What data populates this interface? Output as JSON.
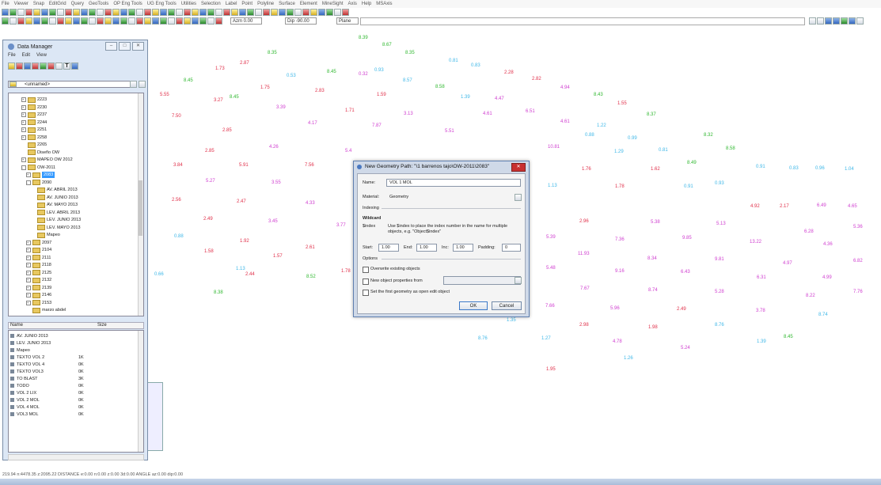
{
  "menubar": [
    "File",
    "Viewer",
    "Snap",
    "EditGrid",
    "Query",
    "GeoTools",
    "OP Eng Tools",
    "UG Eng Tools",
    "Utilities",
    "Selection",
    "Label",
    "Point",
    "Polyline",
    "Surface",
    "Element",
    "MineSight",
    "Axis",
    "Help",
    "MSAxis"
  ],
  "toolbar": {
    "azm": "Azm 0.00",
    "dip": "Dip -90.00",
    "plane_label": "Plane"
  },
  "data_manager": {
    "title": "Data Manager",
    "menu": [
      "File",
      "Edit",
      "View"
    ],
    "combo": "<unnamed>",
    "tree": [
      {
        "label": "2223",
        "indent": 2,
        "exp": "+"
      },
      {
        "label": "2230",
        "indent": 2,
        "exp": "+"
      },
      {
        "label": "2237",
        "indent": 2,
        "exp": "+"
      },
      {
        "label": "2244",
        "indent": 2,
        "exp": "+"
      },
      {
        "label": "2251",
        "indent": 2,
        "exp": "+"
      },
      {
        "label": "2258",
        "indent": 2,
        "exp": "+"
      },
      {
        "label": "2265",
        "indent": 2,
        "exp": ""
      },
      {
        "label": "Diseño OW",
        "indent": 2,
        "exp": ""
      },
      {
        "label": "MAPEO OW 2012",
        "indent": 2,
        "exp": "+"
      },
      {
        "label": "OW-2011",
        "indent": 2,
        "exp": "-"
      },
      {
        "label": "2083",
        "indent": 3,
        "exp": "+",
        "selected": true
      },
      {
        "label": "2090",
        "indent": 3,
        "exp": "-"
      },
      {
        "label": "AV. ABRIL 2013",
        "indent": 4,
        "exp": ""
      },
      {
        "label": "AV. JUNIO 2013",
        "indent": 4,
        "exp": ""
      },
      {
        "label": "AV. MAYO 2013",
        "indent": 4,
        "exp": ""
      },
      {
        "label": "LEV. ABRIL 2013",
        "indent": 4,
        "exp": ""
      },
      {
        "label": "LEV. JUNIO 2013",
        "indent": 4,
        "exp": ""
      },
      {
        "label": "LEV. MAYO 2013",
        "indent": 4,
        "exp": ""
      },
      {
        "label": "Mapeo",
        "indent": 4,
        "exp": ""
      },
      {
        "label": "2097",
        "indent": 3,
        "exp": "+"
      },
      {
        "label": "2104",
        "indent": 3,
        "exp": "+"
      },
      {
        "label": "2111",
        "indent": 3,
        "exp": "+"
      },
      {
        "label": "2118",
        "indent": 3,
        "exp": "+"
      },
      {
        "label": "2125",
        "indent": 3,
        "exp": "+"
      },
      {
        "label": "2132",
        "indent": 3,
        "exp": "+"
      },
      {
        "label": "2139",
        "indent": 3,
        "exp": "+"
      },
      {
        "label": "2146",
        "indent": 3,
        "exp": "+"
      },
      {
        "label": "2153",
        "indent": 3,
        "exp": "+"
      },
      {
        "label": "marzo abdel",
        "indent": 3,
        "exp": ""
      }
    ],
    "list_headers": [
      "Name",
      "Size"
    ],
    "list": [
      {
        "name": "AV. JUNIO 2013",
        "size": ""
      },
      {
        "name": "LEV. JUNIO 2013",
        "size": ""
      },
      {
        "name": "Mapeo",
        "size": ""
      },
      {
        "name": "TEXTO VOL 2",
        "size": "1K"
      },
      {
        "name": "TEXTO VOL 4",
        "size": "0K"
      },
      {
        "name": "TEXTO VOL3",
        "size": "0K"
      },
      {
        "name": "TO BLAST",
        "size": "3K"
      },
      {
        "name": "TODO",
        "size": "0K"
      },
      {
        "name": "VOL 2 LIX",
        "size": "0K"
      },
      {
        "name": "VOL 2 MOL",
        "size": "0K"
      },
      {
        "name": "VOL 4 MOL",
        "size": "0K"
      },
      {
        "name": "VOL3 MOL",
        "size": "0K"
      }
    ]
  },
  "dialog": {
    "title": "New Geometry  Path: \"\\1 barrenos tajo\\OW-2011\\2083\"",
    "name_label": "Name:",
    "name_value": "VOL 1 MOL",
    "material_label": "Material:",
    "material_value": "Geometry",
    "indexing_label": "Indexing",
    "wildcard_label": "Wildcard",
    "index_token": "$index",
    "help_text": "Use $index to place the index number in the name for multiple objects, e.g. \"Object$index\"",
    "start_label": "Start:",
    "start_value": "1.00",
    "end_label": "End:",
    "end_value": "1.00",
    "inc_label": "Inc:",
    "inc_value": "1.00",
    "padding_label": "Padding:",
    "padding_value": "0",
    "options_label": "Options",
    "opt1": "Overwrite existing objects",
    "opt2": "New object properties from",
    "opt3": "Set the first geometry as open edit object",
    "ok": "OK",
    "cancel": "Cancel"
  },
  "canvas_colors": {
    "red": "#e0304a",
    "green": "#30b830",
    "cyan": "#40b8e8",
    "magenta": "#d040d0"
  },
  "values": [
    {
      "t": "8.39",
      "c": "green"
    },
    {
      "t": "8.67",
      "c": "green"
    },
    {
      "t": "8.35",
      "c": "green"
    },
    {
      "t": "8.35",
      "c": "green"
    },
    {
      "t": "1.73",
      "c": "red"
    },
    {
      "t": "2.87",
      "c": "red"
    },
    {
      "t": "8.45",
      "c": "green"
    },
    {
      "t": "0.53",
      "c": "cyan"
    },
    {
      "t": "8.45",
      "c": "green"
    },
    {
      "t": "0.32",
      "c": "magenta"
    },
    {
      "t": "0.93",
      "c": "cyan"
    },
    {
      "t": "8.57",
      "c": "cyan"
    },
    {
      "t": "0.81",
      "c": "cyan"
    },
    {
      "t": "0.83",
      "c": "cyan"
    },
    {
      "t": "2.28",
      "c": "red"
    },
    {
      "t": "2.82",
      "c": "red"
    },
    {
      "t": "1.75",
      "c": "red"
    },
    {
      "t": "2.83",
      "c": "red"
    },
    {
      "t": "5.55",
      "c": "red"
    },
    {
      "t": "3.27",
      "c": "red"
    },
    {
      "t": "8.45",
      "c": "green"
    },
    {
      "t": "1.59",
      "c": "red"
    },
    {
      "t": "8.58",
      "c": "green"
    },
    {
      "t": "1.39",
      "c": "cyan"
    },
    {
      "t": "4.47",
      "c": "magenta"
    },
    {
      "t": "4.94",
      "c": "magenta"
    },
    {
      "t": "8.43",
      "c": "green"
    },
    {
      "t": "1.55",
      "c": "red"
    },
    {
      "t": "7.50",
      "c": "red"
    },
    {
      "t": "3.39",
      "c": "magenta"
    },
    {
      "t": "1.71",
      "c": "red"
    },
    {
      "t": "3.13",
      "c": "magenta"
    },
    {
      "t": "4.61",
      "c": "magenta"
    },
    {
      "t": "6.51",
      "c": "magenta"
    },
    {
      "t": "8.37",
      "c": "green"
    },
    {
      "t": "2.85",
      "c": "red"
    },
    {
      "t": "4.17",
      "c": "magenta"
    },
    {
      "t": "7.87",
      "c": "magenta"
    },
    {
      "t": "5.51",
      "c": "magenta"
    },
    {
      "t": "4.61",
      "c": "magenta"
    },
    {
      "t": "1.22",
      "c": "cyan"
    },
    {
      "t": "0.88",
      "c": "cyan"
    },
    {
      "t": "0.99",
      "c": "cyan"
    },
    {
      "t": "8.32",
      "c": "green"
    },
    {
      "t": "2.85",
      "c": "red"
    },
    {
      "t": "4.26",
      "c": "magenta"
    },
    {
      "t": "5.4",
      "c": "magenta"
    },
    {
      "t": "10.81",
      "c": "magenta"
    },
    {
      "t": "1.29",
      "c": "cyan"
    },
    {
      "t": "0.81",
      "c": "cyan"
    },
    {
      "t": "8.58",
      "c": "green"
    },
    {
      "t": "3.84",
      "c": "red"
    },
    {
      "t": "5.91",
      "c": "red"
    },
    {
      "t": "7.56",
      "c": "red"
    },
    {
      "t": "1.76",
      "c": "red"
    },
    {
      "t": "1.62",
      "c": "red"
    },
    {
      "t": "8.49",
      "c": "green"
    },
    {
      "t": "0.91",
      "c": "cyan"
    },
    {
      "t": "0.83",
      "c": "cyan"
    },
    {
      "t": "0.96",
      "c": "cyan"
    },
    {
      "t": "1.04",
      "c": "cyan"
    },
    {
      "t": "5.27",
      "c": "magenta"
    },
    {
      "t": "3.55",
      "c": "magenta"
    },
    {
      "t": "1.13",
      "c": "cyan"
    },
    {
      "t": "1.78",
      "c": "red"
    },
    {
      "t": "0.91",
      "c": "cyan"
    },
    {
      "t": "0.93",
      "c": "cyan"
    },
    {
      "t": "2.56",
      "c": "red"
    },
    {
      "t": "2.47",
      "c": "red"
    },
    {
      "t": "4.33",
      "c": "magenta"
    },
    {
      "t": "4.92",
      "c": "red"
    },
    {
      "t": "2.17",
      "c": "red"
    },
    {
      "t": "6.49",
      "c": "magenta"
    },
    {
      "t": "4.65",
      "c": "magenta"
    },
    {
      "t": "2.49",
      "c": "red"
    },
    {
      "t": "3.45",
      "c": "magenta"
    },
    {
      "t": "3.77",
      "c": "magenta"
    },
    {
      "t": "2.96",
      "c": "red"
    },
    {
      "t": "5.38",
      "c": "magenta"
    },
    {
      "t": "5.13",
      "c": "magenta"
    },
    {
      "t": "6.28",
      "c": "magenta"
    },
    {
      "t": "5.36",
      "c": "magenta"
    },
    {
      "t": "0.88",
      "c": "cyan"
    },
    {
      "t": "1.92",
      "c": "red"
    },
    {
      "t": "5.39",
      "c": "magenta"
    },
    {
      "t": "7.36",
      "c": "magenta"
    },
    {
      "t": "9.85",
      "c": "magenta"
    },
    {
      "t": "13.22",
      "c": "magenta"
    },
    {
      "t": "4.36",
      "c": "magenta"
    },
    {
      "t": "1.58",
      "c": "red"
    },
    {
      "t": "2.61",
      "c": "red"
    },
    {
      "t": "1.57",
      "c": "red"
    },
    {
      "t": "11.93",
      "c": "magenta"
    },
    {
      "t": "8.34",
      "c": "magenta"
    },
    {
      "t": "9.81",
      "c": "magenta"
    },
    {
      "t": "1.13",
      "c": "cyan"
    },
    {
      "t": "1.78",
      "c": "red"
    },
    {
      "t": "4.97",
      "c": "magenta"
    },
    {
      "t": "6.82",
      "c": "magenta"
    },
    {
      "t": "0.66",
      "c": "cyan"
    },
    {
      "t": "2.44",
      "c": "red"
    },
    {
      "t": "8.52",
      "c": "green"
    },
    {
      "t": "5.48",
      "c": "magenta"
    },
    {
      "t": "9.16",
      "c": "magenta"
    },
    {
      "t": "6.43",
      "c": "magenta"
    },
    {
      "t": "6.31",
      "c": "magenta"
    },
    {
      "t": "4.99",
      "c": "magenta"
    },
    {
      "t": "8.38",
      "c": "green"
    },
    {
      "t": "7.67",
      "c": "magenta"
    },
    {
      "t": "8.74",
      "c": "magenta"
    },
    {
      "t": "5.28",
      "c": "magenta"
    },
    {
      "t": "8.22",
      "c": "magenta"
    },
    {
      "t": "7.76",
      "c": "magenta"
    },
    {
      "t": "7.66",
      "c": "magenta"
    },
    {
      "t": "5.96",
      "c": "magenta"
    },
    {
      "t": "2.49",
      "c": "red"
    },
    {
      "t": "3.78",
      "c": "magenta"
    },
    {
      "t": "8.74",
      "c": "cyan"
    },
    {
      "t": "1.35",
      "c": "cyan"
    },
    {
      "t": "2.98",
      "c": "red"
    },
    {
      "t": "1.98",
      "c": "red"
    },
    {
      "t": "8.76",
      "c": "cyan"
    },
    {
      "t": "8.76",
      "c": "cyan"
    },
    {
      "t": "1.27",
      "c": "cyan"
    },
    {
      "t": "4.78",
      "c": "magenta"
    },
    {
      "t": "5.24",
      "c": "magenta"
    },
    {
      "t": "1.39",
      "c": "cyan"
    },
    {
      "t": "8.45",
      "c": "green"
    },
    {
      "t": "1.26",
      "c": "cyan"
    },
    {
      "t": "1.95",
      "c": "red"
    }
  ],
  "statusbar": "219.94  n:4478.35  z:2095.22   DISTANCE  e:0.00  n:0.00  z:0.00  3d:0.00   ANGLE  az:0.00  dip:0.00"
}
